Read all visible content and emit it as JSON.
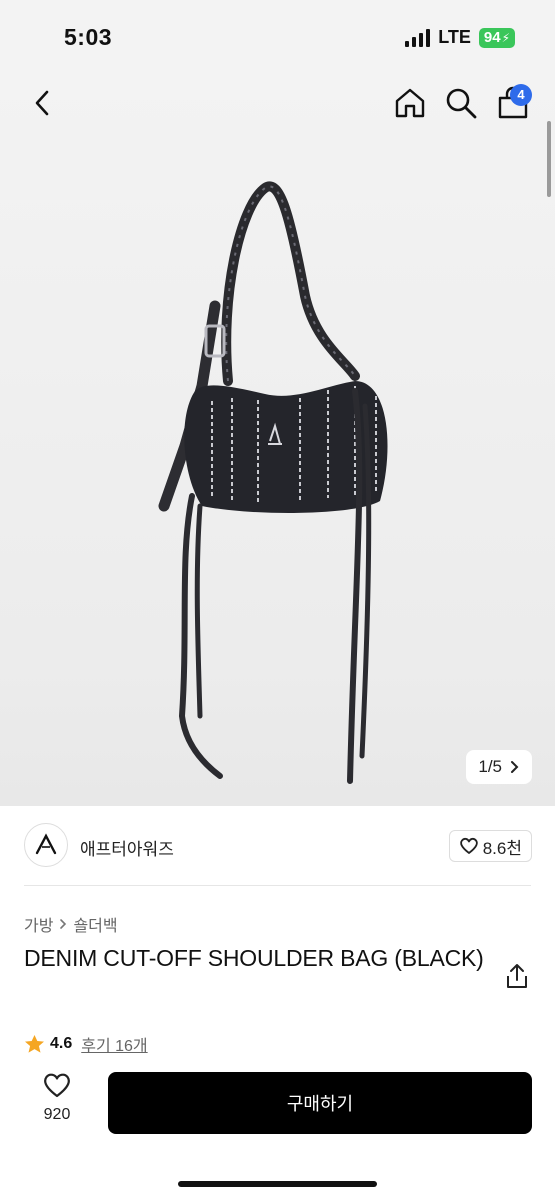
{
  "status_bar": {
    "time": "5:03",
    "network": "LTE",
    "battery": "94"
  },
  "nav": {
    "cart_count": "4"
  },
  "hero": {
    "pager": "1/5"
  },
  "brand": {
    "name": "애프터아워즈",
    "likes": "8.6천"
  },
  "product": {
    "breadcrumb": [
      "가방",
      "숄더백"
    ],
    "title": "DENIM CUT-OFF SHOULDER BAG (BLACK)",
    "rating": "4.6",
    "reviews": "후기 16개"
  },
  "bottom": {
    "wish_count": "920",
    "buy_label": "구매하기"
  },
  "colors": {
    "accent_badge": "#2e6bea",
    "battery": "#3ac65a",
    "star": "#f5a623",
    "buy_bg": "#000000"
  }
}
